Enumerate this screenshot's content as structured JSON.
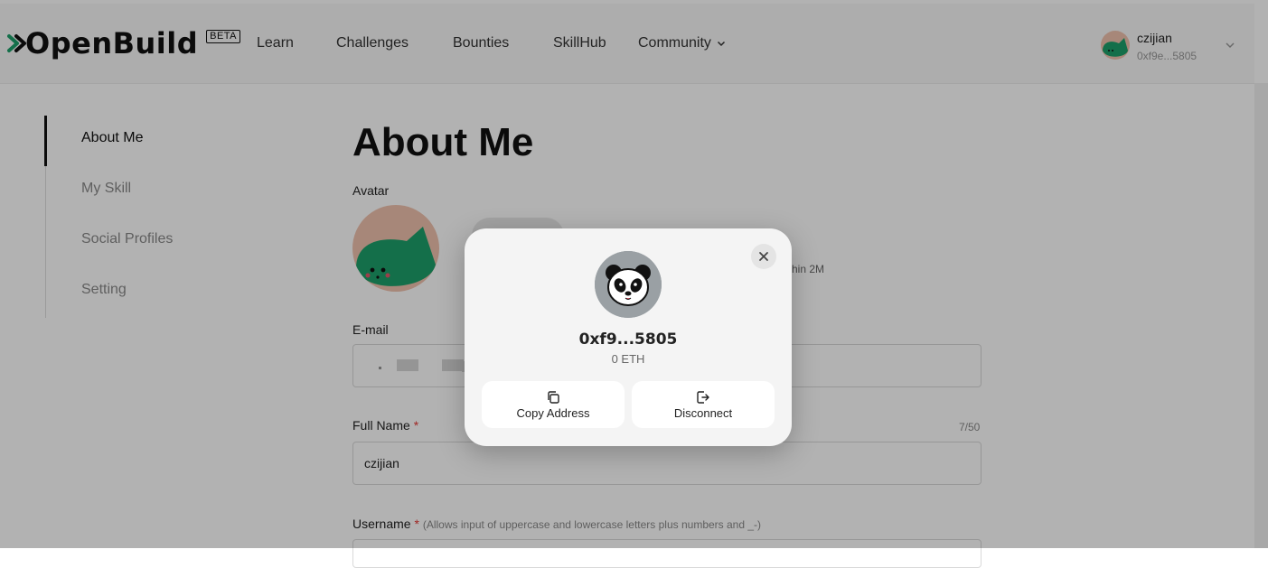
{
  "header": {
    "brand": "OpenBuild",
    "beta": "BETA",
    "nav": [
      "Learn",
      "Challenges",
      "Bounties",
      "SkillHub",
      "Community"
    ],
    "user": {
      "name": "czijian",
      "address": "0xf9e...5805"
    }
  },
  "sidebar": {
    "items": [
      {
        "label": "About Me",
        "active": true
      },
      {
        "label": "My Skill",
        "active": false
      },
      {
        "label": "Social Profiles",
        "active": false
      },
      {
        "label": "Setting",
        "active": false
      }
    ]
  },
  "main": {
    "title": "About Me",
    "avatar_label": "Avatar",
    "upload_note_fragment": "hin 2M",
    "email_label": "E-mail",
    "fullname_label": "Full Name",
    "fullname_value": "czijian",
    "fullname_counter": "7/50",
    "username_label": "Username",
    "username_hint": "(Allows input of uppercase and lowercase letters plus numbers and _-)",
    "required_mark": "*"
  },
  "modal": {
    "address": "0xf9...5805",
    "balance": "0 ETH",
    "copy_label": "Copy Address",
    "disconnect_label": "Disconnect"
  },
  "colors": {
    "avatar_bg": "#f0c2ae",
    "avatar_fg": "#1ea06a",
    "required": "#e53935",
    "overlay": "rgba(0,0,0,0.3)"
  }
}
